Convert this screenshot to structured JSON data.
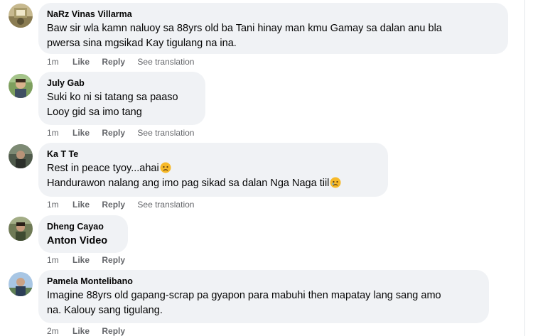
{
  "comments": [
    {
      "author": "NaRz Vinas Villarma",
      "lines": [
        "Baw sir wla kamn naluoy sa 88yrs old ba Tani hinay man kmu Gamay sa dalan anu bla",
        "pwersa sina mgsikad Kay tigulang na ina."
      ],
      "time": "1m",
      "like": "Like",
      "reply": "Reply",
      "translation": "See translation",
      "avatar": "avatar-narz"
    },
    {
      "author": "July Gab",
      "lines": [
        "Suki ko ni si tatang sa paaso",
        "Looy gid sa imo tang"
      ],
      "time": "1m",
      "like": "Like",
      "reply": "Reply",
      "translation": "See translation",
      "avatar": "avatar-july"
    },
    {
      "author": "Ka T Te",
      "lines": [
        "Rest in peace tyoy...ahai",
        "Handurawon nalang ang imo pag sikad sa dalan Nga Naga tiil"
      ],
      "emoji": "sad-face-emoji",
      "time": "1m",
      "like": "Like",
      "reply": "Reply",
      "translation": "See translation",
      "avatar": "avatar-ka"
    },
    {
      "author": "Dheng Cayao",
      "lines": [
        "Anton Video"
      ],
      "time": "1m",
      "like": "Like",
      "reply": "Reply",
      "avatar": "avatar-dheng"
    },
    {
      "author": "Pamela Montelibano",
      "lines": [
        "Imagine 88yrs old gapang-scrap pa gyapon para mabuhi then mapatay lang sang amo",
        "na. Kalouy sang tigulang."
      ],
      "time": "2m",
      "like": "Like",
      "reply": "Reply",
      "avatar": "avatar-pamela"
    }
  ],
  "colors": {
    "bubble": "#f0f2f5",
    "meta_text": "#65676b",
    "text": "#050505",
    "emoji_face": "#f7b928"
  }
}
